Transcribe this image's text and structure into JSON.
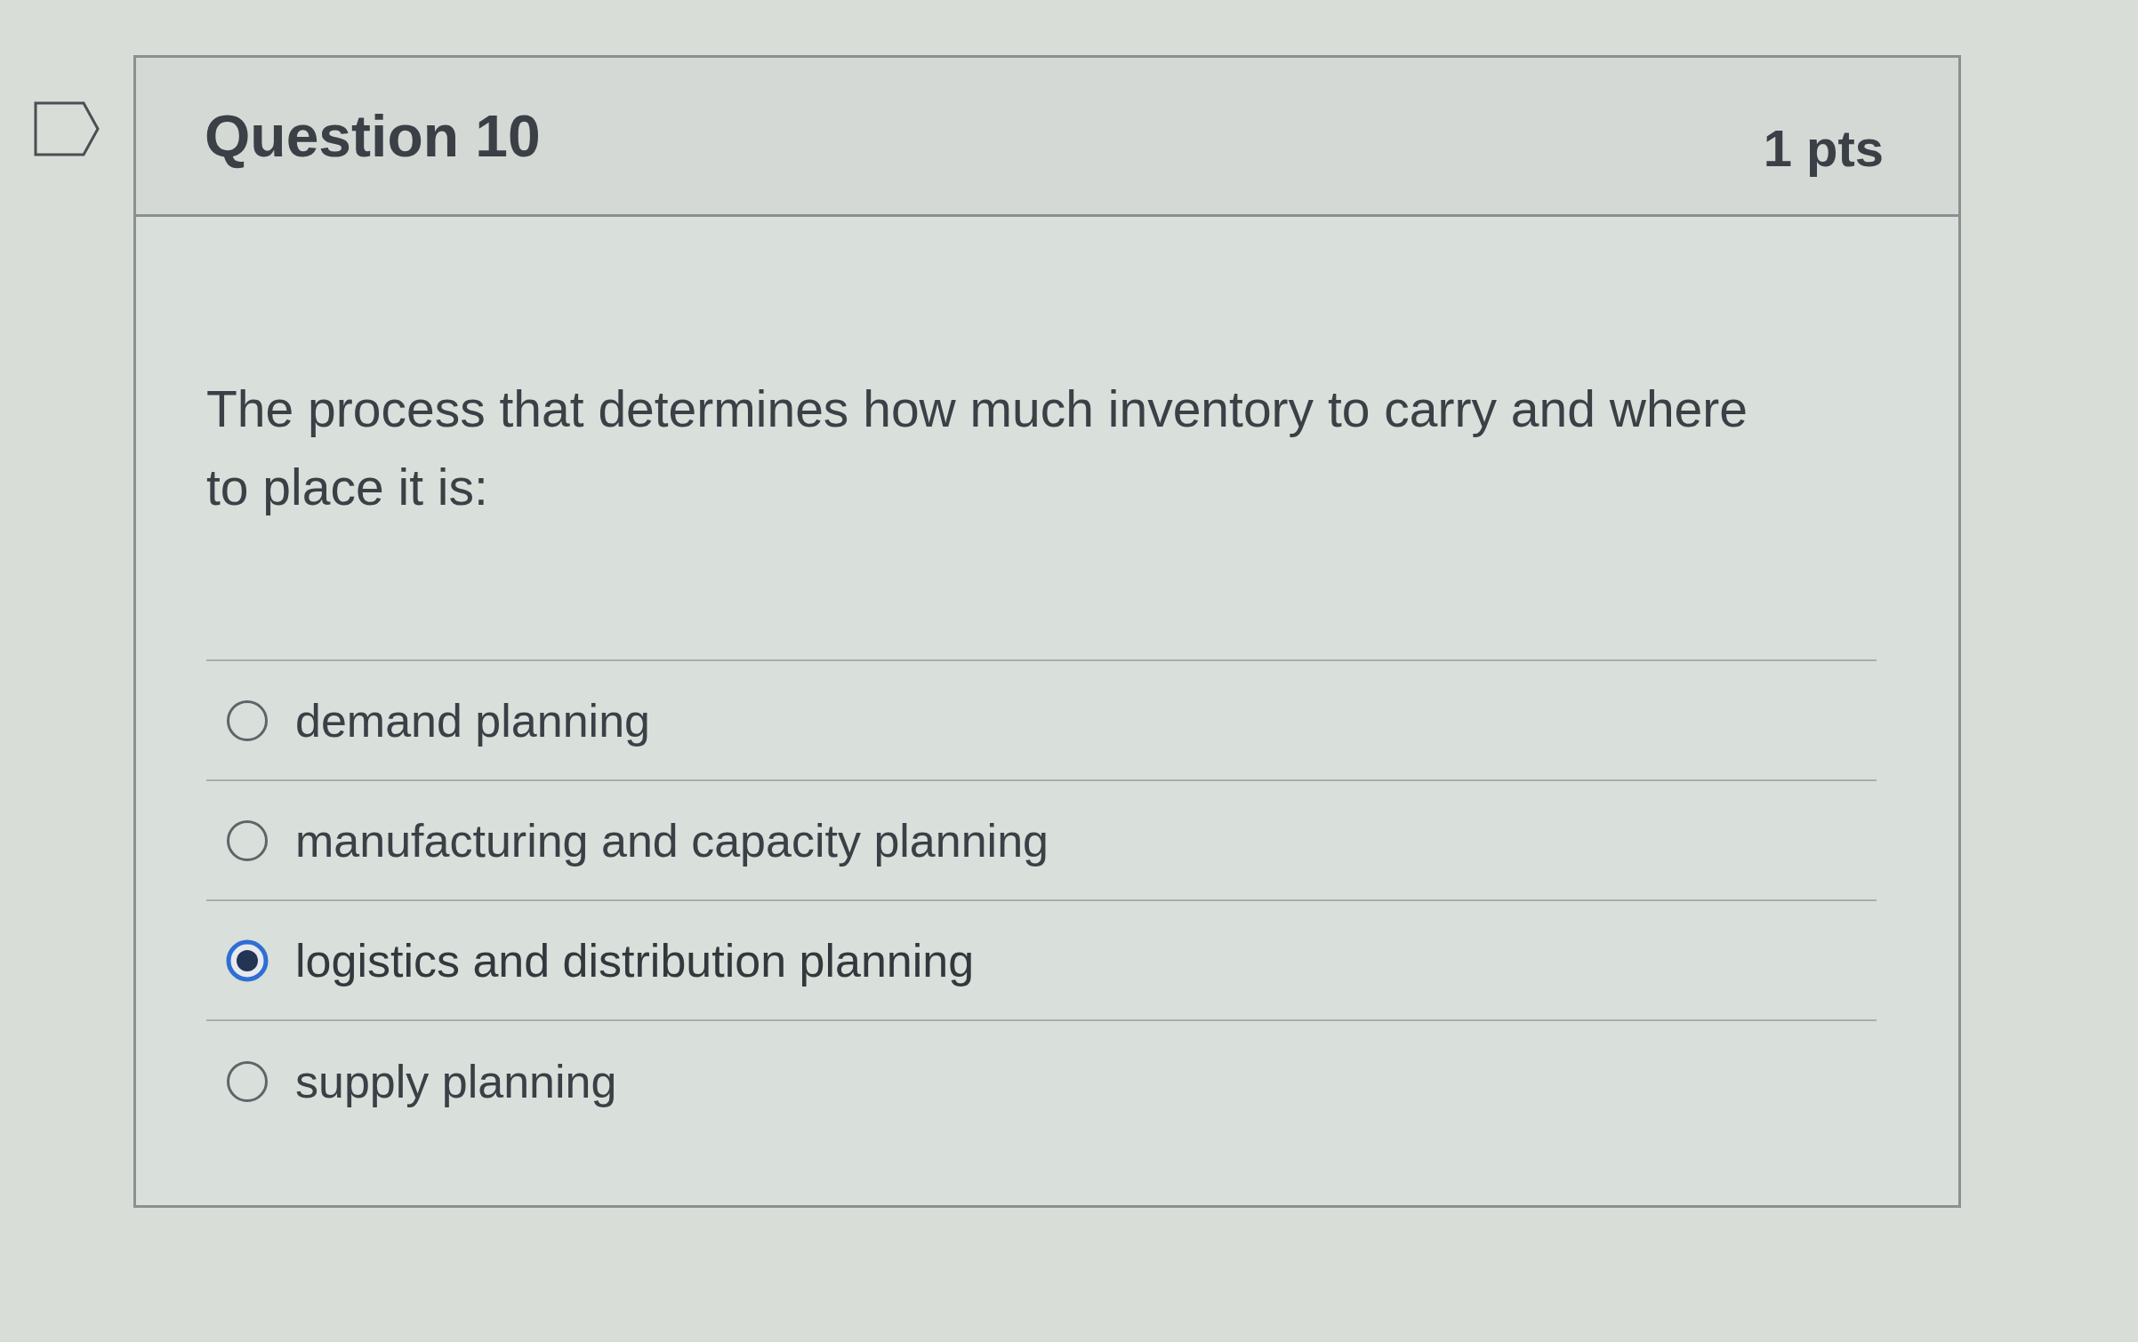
{
  "flagged": false,
  "question": {
    "title": "Question 10",
    "points": "1 pts",
    "text": "The process that determines how much inventory to carry and where to place it is:",
    "options": [
      {
        "label": "demand planning",
        "selected": false
      },
      {
        "label": "manufacturing and capacity planning",
        "selected": false
      },
      {
        "label": "logistics and distribution planning",
        "selected": true
      },
      {
        "label": "supply planning",
        "selected": false
      }
    ]
  }
}
